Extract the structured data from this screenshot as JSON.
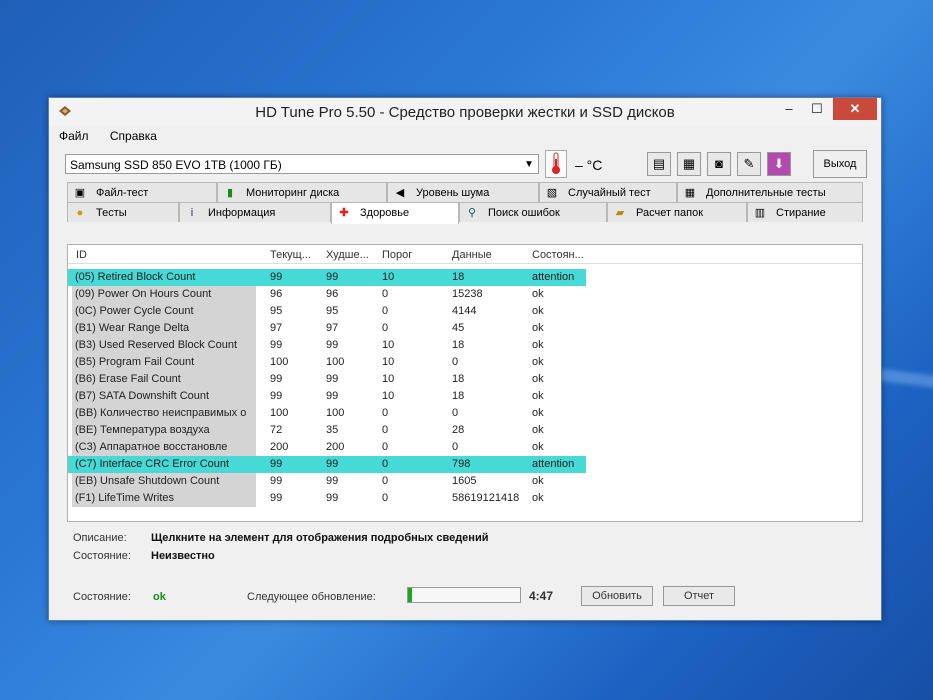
{
  "window": {
    "title": "HD Tune Pro 5.50 - Средство проверки жестки и SSD дисков",
    "minimize": "–",
    "maximize": "☐",
    "close": "✕"
  },
  "menu": [
    "Файл",
    "Справка"
  ],
  "toolbar": {
    "drive": "Samsung SSD 850 EVO 1TB (1000 ГБ)",
    "temperature": "– °C",
    "exit": "Выход"
  },
  "tabs_top": [
    "Файл-тест",
    "Мониторинг диска",
    "Уровень шума",
    "Случайный тест",
    "Дополнительные тесты"
  ],
  "tabs_bottom": [
    "Тесты",
    "Информация",
    "Здоровье",
    "Поиск ошибок",
    "Расчет папок",
    "Стирание"
  ],
  "table": {
    "columns": [
      "ID",
      "Текущ...",
      "Худше...",
      "Порог",
      "Данные",
      "Состоян..."
    ],
    "rows": [
      {
        "id": "(05) Retired Block Count",
        "cur": "99",
        "worst": "99",
        "thr": "10",
        "data": "18",
        "status": "attention"
      },
      {
        "id": "(09) Power On Hours Count",
        "cur": "96",
        "worst": "96",
        "thr": "0",
        "data": "15238",
        "status": "ok"
      },
      {
        "id": "(0C) Power Cycle Count",
        "cur": "95",
        "worst": "95",
        "thr": "0",
        "data": "4144",
        "status": "ok"
      },
      {
        "id": "(B1) Wear Range Delta",
        "cur": "97",
        "worst": "97",
        "thr": "0",
        "data": "45",
        "status": "ok"
      },
      {
        "id": "(B3) Used Reserved Block Count",
        "cur": "99",
        "worst": "99",
        "thr": "10",
        "data": "18",
        "status": "ok"
      },
      {
        "id": "(B5) Program Fail Count",
        "cur": "100",
        "worst": "100",
        "thr": "10",
        "data": "0",
        "status": "ok"
      },
      {
        "id": "(B6) Erase Fail Count",
        "cur": "99",
        "worst": "99",
        "thr": "10",
        "data": "18",
        "status": "ok"
      },
      {
        "id": "(B7) SATA Downshift Count",
        "cur": "99",
        "worst": "99",
        "thr": "10",
        "data": "18",
        "status": "ok"
      },
      {
        "id": "(BB) Количество неисправимых о",
        "cur": "100",
        "worst": "100",
        "thr": "0",
        "data": "0",
        "status": "ok"
      },
      {
        "id": "(BE) Температура воздуха",
        "cur": "72",
        "worst": "35",
        "thr": "0",
        "data": "28",
        "status": "ok"
      },
      {
        "id": "(C3) Аппаратное восстановле",
        "cur": "200",
        "worst": "200",
        "thr": "0",
        "data": "0",
        "status": "ok"
      },
      {
        "id": "(C7) Interface CRC Error Count",
        "cur": "99",
        "worst": "99",
        "thr": "0",
        "data": "798",
        "status": "attention"
      },
      {
        "id": "(EB) Unsafe Shutdown Count",
        "cur": "99",
        "worst": "99",
        "thr": "0",
        "data": "1605",
        "status": "ok"
      },
      {
        "id": "(F1) LifeTime Writes",
        "cur": "99",
        "worst": "99",
        "thr": "0",
        "data": "58619121418",
        "status": "ok"
      }
    ]
  },
  "info": {
    "description_label": "Описание:",
    "description_value": "Щелкните на элемент для отображения подробных сведений",
    "state_label": "Состояние:",
    "state_value": "Неизвестно"
  },
  "status": {
    "label": "Состояние:",
    "value": "ok",
    "next_update_label": "Следующее обновление:",
    "progress": 0.04,
    "time": "4:47",
    "refresh": "Обновить",
    "report": "Отчет"
  },
  "colors": {
    "attention": "#47d9d6",
    "ok": "#1a8a1a",
    "close": "#c94a3a"
  }
}
